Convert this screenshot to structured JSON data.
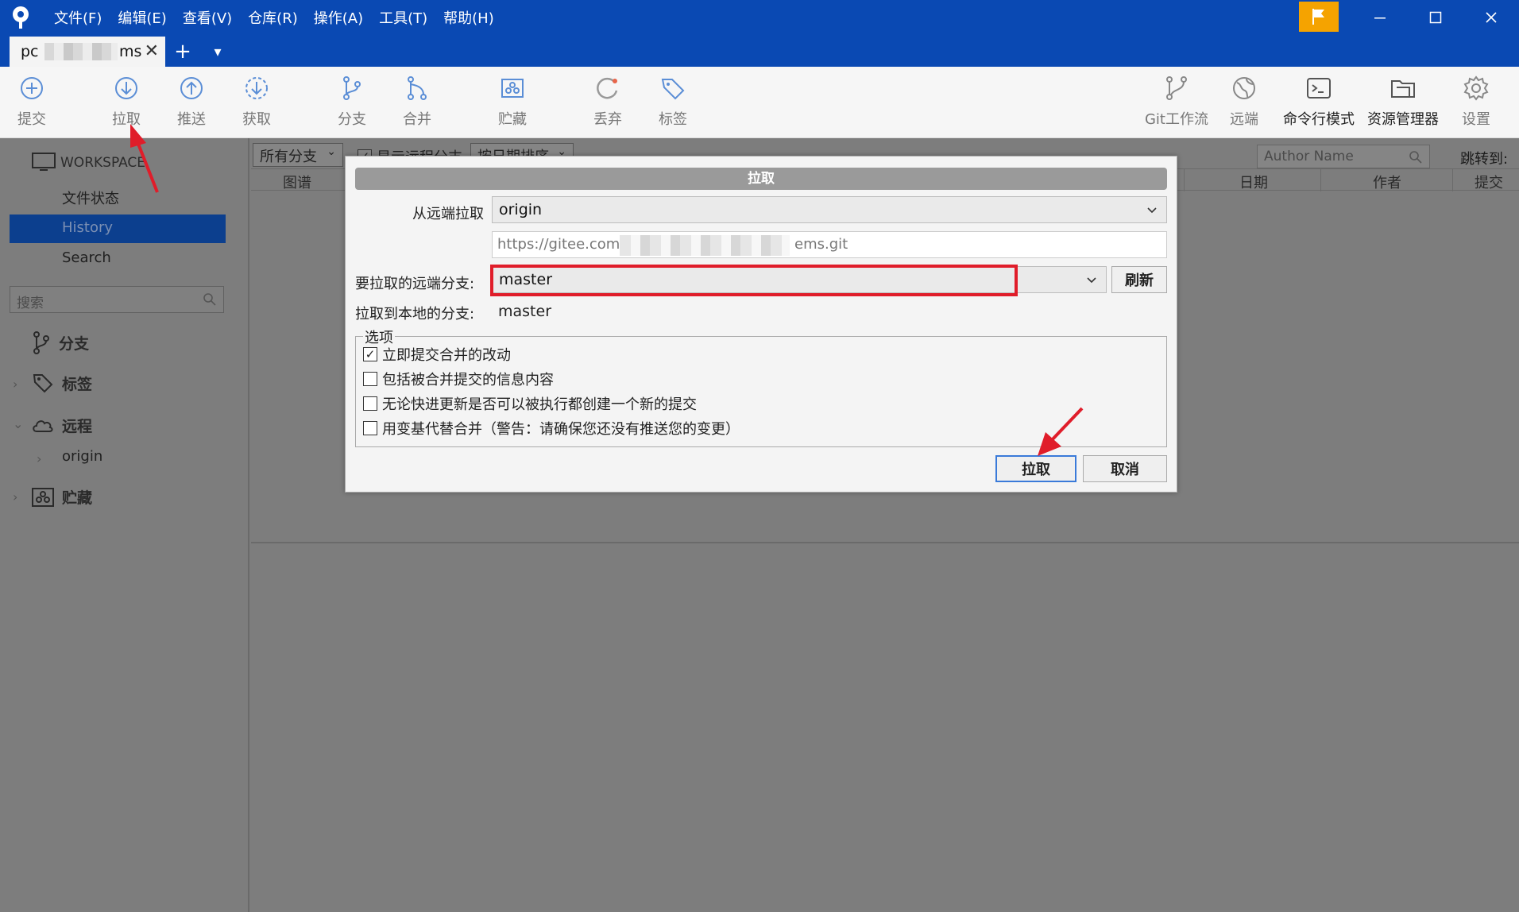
{
  "menu": [
    "文件(F)",
    "编辑(E)",
    "查看(V)",
    "仓库(R)",
    "操作(A)",
    "工具(T)",
    "帮助(H)"
  ],
  "tabs": {
    "repo_tab_title_start": "pc",
    "repo_tab_title_end": "ms",
    "new_tab": "+",
    "dropdown": "▾"
  },
  "toolbar": {
    "commit": "提交",
    "pull": "拉取",
    "push": "推送",
    "fetch": "获取",
    "branch": "分支",
    "merge": "合并",
    "stash": "贮藏",
    "discard": "丢弃",
    "tag": "标签",
    "git_flow": "Git工作流",
    "remote": "远端",
    "terminal": "命令行模式",
    "explorer": "资源管理器",
    "settings": "设置"
  },
  "sidebar": {
    "workspace": "WORKSPACE",
    "file_status": "文件状态",
    "history": "History",
    "search": "Search",
    "search_placeholder": "搜索",
    "branches": "分支",
    "tags": "标签",
    "remotes": "远程",
    "remote_origin": "origin",
    "stashes": "贮藏"
  },
  "content": {
    "all_branches": "所有分支",
    "show_remote": "显示远程分支",
    "sort_by_date": "按日期排序",
    "author_placeholder": "Author Name",
    "jump_to": "跳转到:",
    "columns": {
      "graph": "图谱",
      "date": "日期",
      "author": "作者",
      "commit": "提交"
    }
  },
  "dialog": {
    "title": "拉取",
    "pull_from_label": "从远端拉取",
    "remote_value": "origin",
    "url_start": "https://gitee.com/",
    "url_end": "ems.git",
    "remote_branch_label": "要拉取的远端分支:",
    "remote_branch_value": "master",
    "refresh_button": "刷新",
    "local_branch_label": "拉取到本地的分支:",
    "local_branch_value": "master",
    "options_legend": "选项",
    "options": [
      {
        "label": "立即提交合并的改动",
        "checked": true
      },
      {
        "label": "包括被合并提交的信息内容",
        "checked": false
      },
      {
        "label": "无论快进更新是否可以被执行都创建一个新的提交",
        "checked": false
      },
      {
        "label": "用变基代替合并（警告：请确保您还没有推送您的变更）",
        "checked": false
      }
    ],
    "ok_button": "拉取",
    "cancel_button": "取消"
  },
  "colors": {
    "titlebar": "#0a49b3",
    "flag": "#f5a300",
    "annotation": "#e01d2a",
    "history_selected": "#0c3f8e"
  }
}
